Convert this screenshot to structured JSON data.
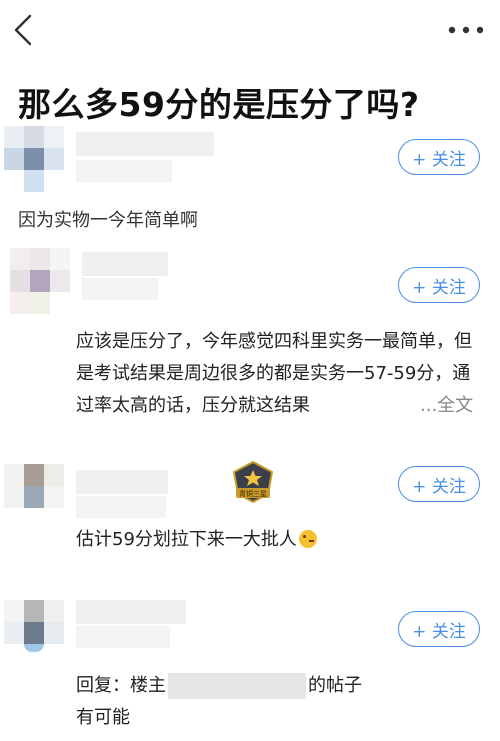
{
  "header": {
    "back_icon": "chevron-left-icon",
    "more_icon": "ellipsis-icon"
  },
  "question": {
    "title": "那么多59分的是压分了吗?"
  },
  "answers": [
    {
      "follow_label": "+ 关注",
      "text": "因为实物一今年简单啊"
    },
    {
      "follow_label": "+ 关注",
      "text": "应该是压分了，今年感觉四科里实务一最简单，但是考试结果是周边很多的都是实务一57-59分，通过率太高的话，压分就这结果",
      "ellipsis": "...",
      "full_text_label": "全文"
    },
    {
      "follow_label": "+ 关注",
      "badge_text": "青铜三星",
      "text": "估计59分划拉下来一大批人"
    },
    {
      "follow_label": "+ 关注",
      "reply_prefix": "回复：楼主",
      "reply_suffix": "的帖子",
      "text": "有可能"
    }
  ],
  "colors": {
    "accent": "#4a90e2",
    "title": "#111111",
    "body_text": "#222222",
    "muted": "#888888"
  }
}
